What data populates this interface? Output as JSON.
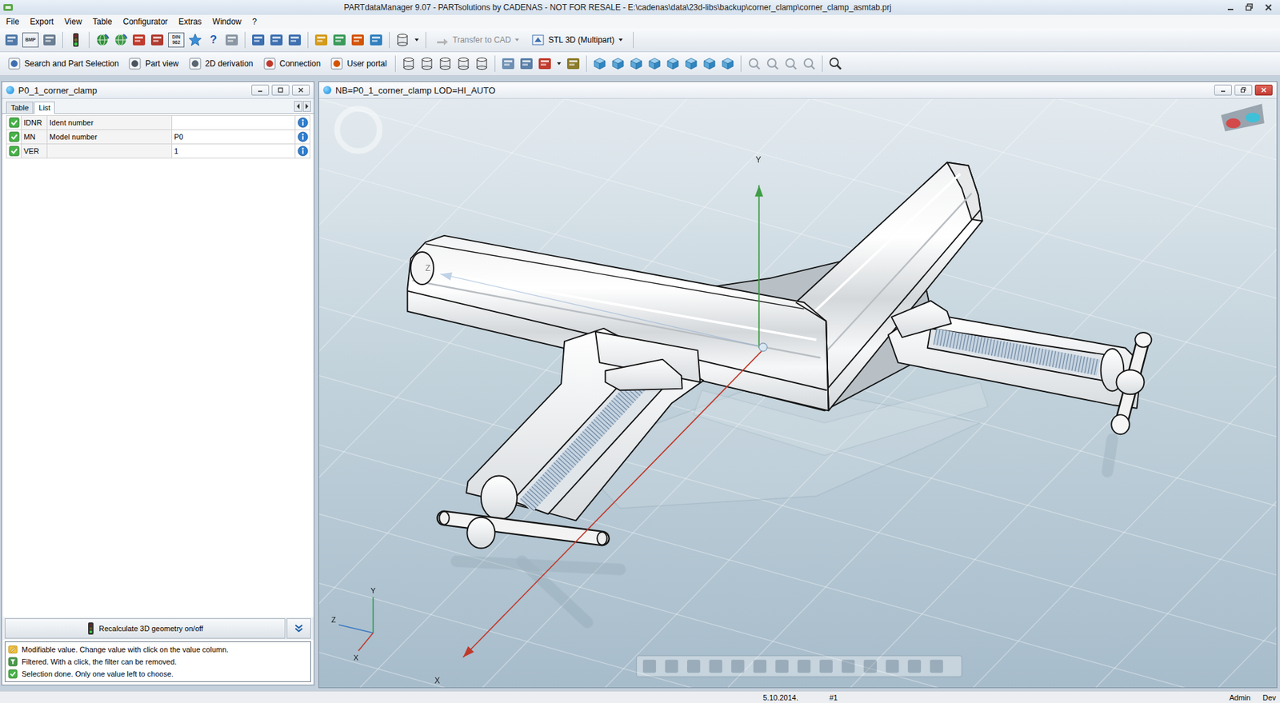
{
  "window": {
    "title": "PARTdataManager 9.07 - PARTsolutions by CADENAS - NOT FOR RESALE - E:\\cadenas\\data\\23d-libs\\backup\\corner_clamp\\corner_clamp_asmtab.prj"
  },
  "menu": [
    "File",
    "Export",
    "View",
    "Table",
    "Configurator",
    "Extras",
    "Window",
    "?"
  ],
  "toolbar": {
    "badge_icons": [
      {
        "lines": [
          "BMP"
        ]
      },
      {
        "lines": [
          "DIN",
          "962"
        ]
      }
    ],
    "glyph_icons": [
      "?"
    ],
    "buttons": [
      {
        "label": "Transfer to CAD",
        "disabled": true
      },
      {
        "label": "STL 3D (Multipart)",
        "disabled": false
      }
    ]
  },
  "nav_buttons": [
    {
      "label": "Search and Part Selection"
    },
    {
      "label": "Part view"
    },
    {
      "label": "2D derivation"
    },
    {
      "label": "Connection"
    },
    {
      "label": "User portal"
    }
  ],
  "left_panel": {
    "title": "P0_1_corner_clamp",
    "tabs": [
      {
        "label": "Table",
        "selected": false
      },
      {
        "label": "List",
        "selected": true
      }
    ],
    "rows": [
      {
        "key": "IDNR",
        "description": "Ident number",
        "value": "",
        "checked": true
      },
      {
        "key": "MN",
        "description": "Model number",
        "value": "P0",
        "checked": true
      },
      {
        "key": "VER",
        "description": "",
        "value": "1",
        "checked": true
      }
    ],
    "recalc_button": "Recalculate 3D geometry on/off",
    "legend": [
      {
        "kind": "modifiable",
        "text": "Modifiable value. Change value with click on the value column."
      },
      {
        "kind": "filtered",
        "text": "Filtered. With a click, the filter can be removed."
      },
      {
        "kind": "selected",
        "text": "Selection done. Only one value left to choose."
      }
    ]
  },
  "viewport": {
    "title": "NB=P0_1_corner_clamp LOD=HI_AUTO",
    "axes": [
      {
        "label": "Y",
        "color": "#3f9e45"
      },
      {
        "label": "Z",
        "color": "#8fb0d4"
      },
      {
        "label": "X",
        "color": "#c0392b"
      }
    ],
    "triad": [
      {
        "label": "Y",
        "color": "#2e9e4f"
      },
      {
        "label": "Z",
        "color": "#3a78c2"
      },
      {
        "label": "X",
        "color": "#c0392b"
      }
    ]
  },
  "status_bar": [
    "5.10.2014.",
    "#1",
    "Admin",
    "Dev"
  ]
}
